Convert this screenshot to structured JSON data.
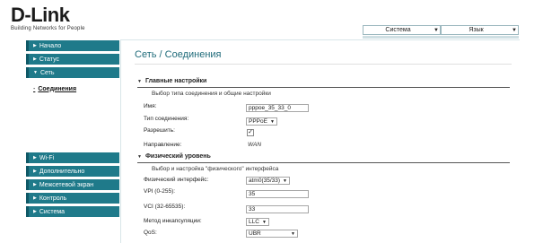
{
  "logo": {
    "name": "D-Link",
    "tagline": "Building Networks for People"
  },
  "top": {
    "system_label": "Система",
    "language_label": "Язык"
  },
  "sidebar": {
    "items": [
      {
        "label": "Начало"
      },
      {
        "label": "Статус"
      },
      {
        "label": "Сеть"
      }
    ],
    "subitem": "Соединения",
    "items2": [
      {
        "label": "Wi-Fi"
      },
      {
        "label": "Дополнительно"
      },
      {
        "label": "Межсетевой экран"
      },
      {
        "label": "Контроль"
      },
      {
        "label": "Система"
      }
    ]
  },
  "main": {
    "title": "Сеть / Соединения",
    "general": {
      "heading": "Главные настройки",
      "desc": "Выбор типа соединения и общие настройки",
      "name_label": "Имя:",
      "name_value": "pppoe_35_33_0",
      "type_label": "Тип соединения:",
      "type_value": "PPPoE",
      "enable_label": "Разрешить:",
      "enable_checked": "✓",
      "direction_label": "Направление:",
      "direction_value": "WAN"
    },
    "physical": {
      "heading": "Физический уровень",
      "desc": "Выбор и настройка \"физического\" интерфейса",
      "iface_label": "Физический интерфейс:",
      "iface_value": "atm0(35/33)",
      "vpi_label": "VPI (0-255):",
      "vpi_value": "35",
      "vci_label": "VCI (32-65535):",
      "vci_value": "33",
      "encap_label": "Метод инкапсуляции:",
      "encap_value": "LLC",
      "qos_label": "QoS:",
      "qos_value": "UBR"
    }
  }
}
